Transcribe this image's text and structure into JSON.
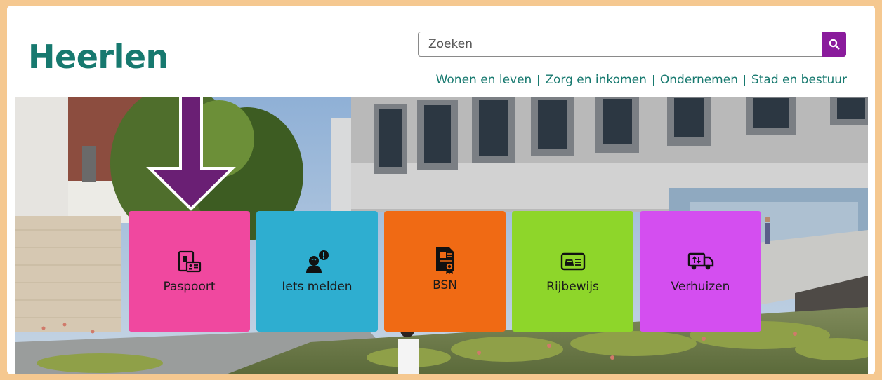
{
  "header": {
    "logo": "Heerlen",
    "search": {
      "placeholder": "Zoeken"
    },
    "nav": [
      "Wonen en leven",
      "Zorg en inkomen",
      "Ondernemen",
      "Stad en bestuur"
    ]
  },
  "tiles": [
    {
      "label": "Paspoort",
      "icon": "passport-icon",
      "color": "#f0489f"
    },
    {
      "label": "Iets melden",
      "icon": "report-person-icon",
      "color": "#2eaed0"
    },
    {
      "label": "BSN",
      "icon": "certificate-document-icon",
      "color": "#f06a14"
    },
    {
      "label": "Rijbewijs",
      "icon": "driving-license-icon",
      "color": "#8ed62a"
    },
    {
      "label": "Verhuizen",
      "icon": "moving-truck-icon",
      "color": "#d44ef0"
    }
  ],
  "colors": {
    "brand": "#17796f",
    "search_button": "#8a1b9c",
    "arrow": "#6a1f74",
    "frame": "#f5c890"
  }
}
